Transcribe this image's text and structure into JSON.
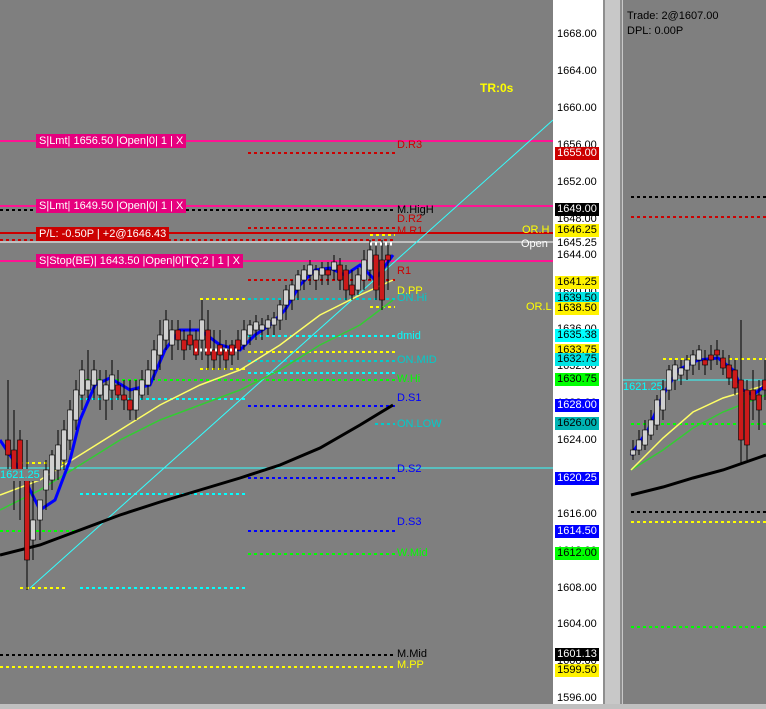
{
  "left_chart": {
    "timer": "TR:0s",
    "orders": [
      {
        "text": "S|Lmt| 1656.50 |Open|0| 1 | X"
      },
      {
        "text": "S|Lmt| 1649.50 |Open|0| 1 | X"
      },
      {
        "text": "S|Stop(BE)| 1643.50 |Open|0|TQ:2 | 1 | X"
      }
    ],
    "pnl_text": "P/L: -0.50P | +2@1646.43",
    "cyan_level_label": "1621.25",
    "level_labels": {
      "d_r3": "D.R3",
      "m_high": "M.HigH",
      "d_r2": "D.R2",
      "m_r1": "M.R1",
      "or_h": "OR.H",
      "open": "Open",
      "r1": "R1",
      "d_pp": "D.PP",
      "on_hi": "ON.Hi",
      "or_l": "OR.L",
      "dmid": "dmid",
      "on_mid": "ON.MID",
      "w_hi": "W.Hi",
      "d_s1": "D.S1",
      "on_low": "ON.LOW",
      "d_s2": "D.S2",
      "d_s3": "D.S3",
      "w_mid": "W.Mid",
      "m_mid": "M.Mid",
      "m_pp": "M.PP"
    }
  },
  "price_axis": {
    "ticks": [
      "1668.00",
      "1664.00",
      "1660.00",
      "1656.00",
      "1652.00",
      "1648.00",
      "1644.00",
      "1640.00",
      "1636.00",
      "1632.00",
      "1628.00",
      "1624.00",
      "1620.00",
      "1616.00",
      "1612.00",
      "1608.00",
      "1604.00",
      "1600.00",
      "1596.00"
    ],
    "tags": [
      {
        "text": "1655.00",
        "bg": "#cc0000",
        "fg": "#ffffff"
      },
      {
        "text": "1649.00",
        "bg": "#000000",
        "fg": "#ffffff"
      },
      {
        "text": "1646.25",
        "bg": "#fff200",
        "fg": "#000000"
      },
      {
        "text": "1645.25",
        "bg": "#ffffff",
        "fg": "#000000"
      },
      {
        "text": "1641.25",
        "bg": "#fff200",
        "fg": "#000000"
      },
      {
        "text": "1639.50",
        "bg": "#00e5e5",
        "fg": "#000000"
      },
      {
        "text": "1638.50",
        "bg": "#fff200",
        "fg": "#000000"
      },
      {
        "text": "1635.38",
        "bg": "#00ffff",
        "fg": "#000000"
      },
      {
        "text": "1633.75",
        "bg": "#fff200",
        "fg": "#000000"
      },
      {
        "text": "1632.75",
        "bg": "#00e5e5",
        "fg": "#000000"
      },
      {
        "text": "1630.75",
        "bg": "#00ff00",
        "fg": "#000000"
      },
      {
        "text": "1628.00",
        "bg": "#0000ff",
        "fg": "#ffffff"
      },
      {
        "text": "1626.00",
        "bg": "#00b3b3",
        "fg": "#000000"
      },
      {
        "text": "1620.25",
        "bg": "#0000ff",
        "fg": "#ffffff"
      },
      {
        "text": "1614.50",
        "bg": "#0000ff",
        "fg": "#ffffff"
      },
      {
        "text": "1612.00",
        "bg": "#00ff00",
        "fg": "#000000"
      },
      {
        "text": "1601.13",
        "bg": "#000000",
        "fg": "#ffffff"
      },
      {
        "text": "1599.50",
        "bg": "#fff200",
        "fg": "#000000"
      }
    ]
  },
  "right_chart": {
    "trade": "Trade: 2@1607.00",
    "dpl": "DPL: 0.00P",
    "cyan_level_label": "1621.25"
  },
  "colors": {
    "chart_bg": "#7f7f7f",
    "order_bar": "#e6007e",
    "pnl_bar": "#cc0000",
    "sma_blue": "#0000ff",
    "ema_yellow": "#ffff66",
    "ema_green": "#33cc33",
    "ma_black": "#000000",
    "trend_cyan": "#33ffff"
  }
}
